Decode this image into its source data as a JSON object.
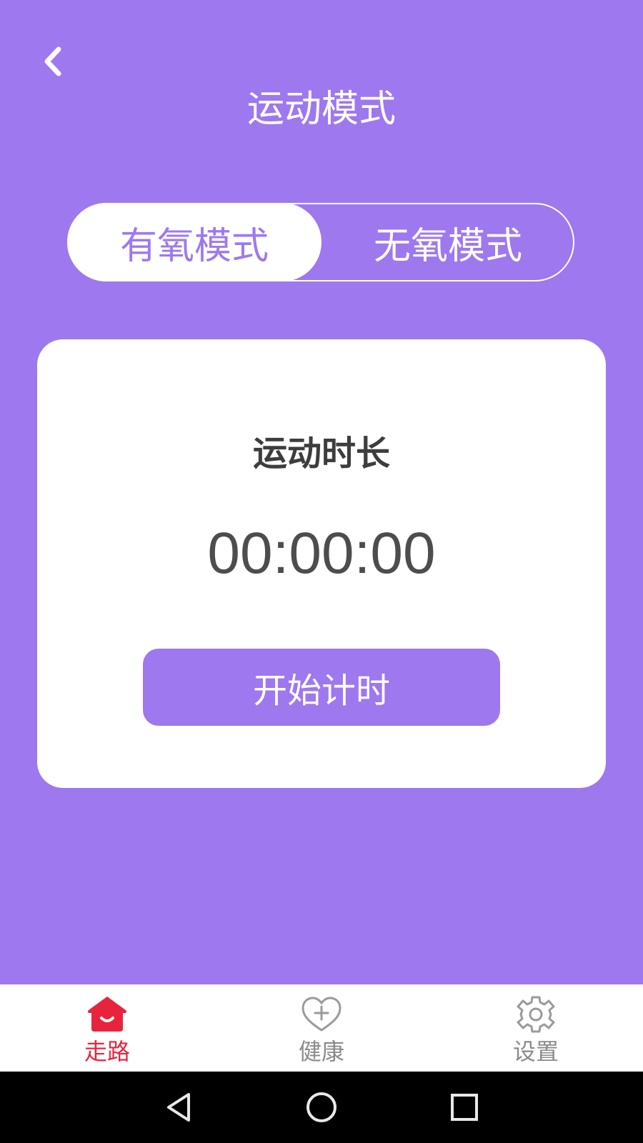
{
  "header": {
    "title": "运动模式",
    "back_icon": "chevron-left-icon"
  },
  "mode_switch": {
    "options": [
      {
        "label": "有氧模式",
        "selected": true
      },
      {
        "label": "无氧模式",
        "selected": false
      }
    ]
  },
  "timer_card": {
    "title": "运动时长",
    "time": "00:00:00",
    "start_label": "开始计时"
  },
  "tabbar": {
    "items": [
      {
        "label": "走路",
        "icon": "home-icon",
        "active": true
      },
      {
        "label": "健康",
        "icon": "heart-plus-icon",
        "active": false
      },
      {
        "label": "设置",
        "icon": "gear-icon",
        "active": false
      }
    ]
  },
  "system_nav": {
    "icons": [
      "back-triangle-icon",
      "home-circle-icon",
      "recents-square-icon"
    ]
  },
  "colors": {
    "accent": "#9e78ee",
    "active_tab": "#e8243d",
    "inactive_tab": "#8a8a8a",
    "text_dark": "#3d3d3d"
  }
}
